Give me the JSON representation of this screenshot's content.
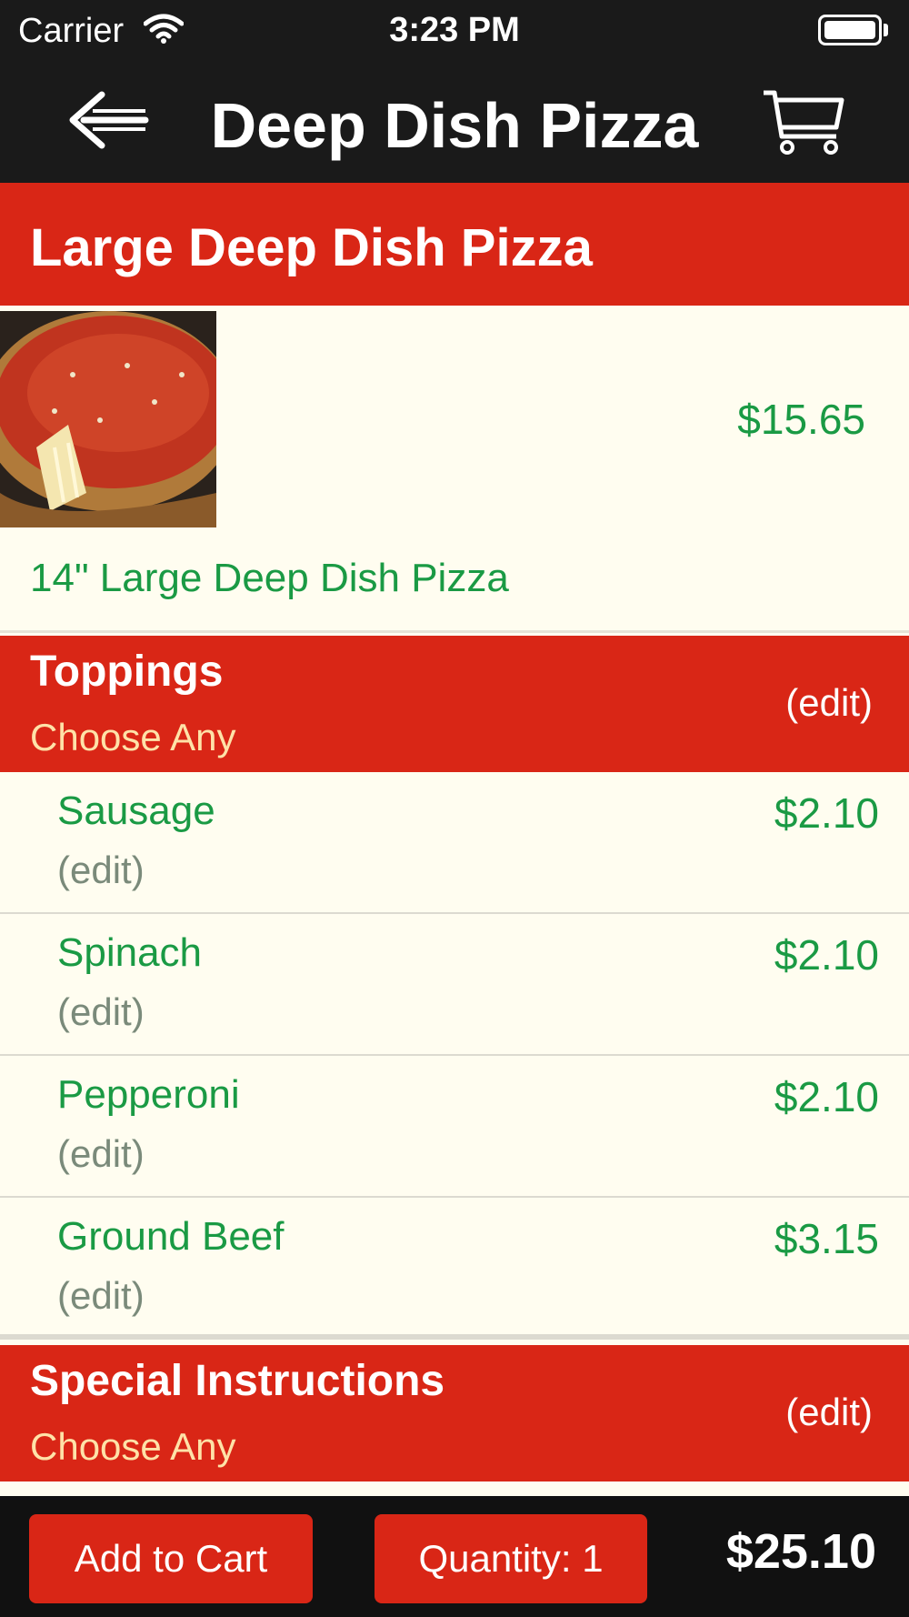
{
  "status_bar": {
    "carrier": "Carrier",
    "time": "3:23 PM",
    "wifi_icon": "wifi-icon",
    "battery_icon": "battery-icon"
  },
  "nav": {
    "title": "Deep Dish Pizza",
    "back_icon": "back-arrow-icon",
    "cart_icon": "cart-icon"
  },
  "item": {
    "name": "Large Deep Dish Pizza",
    "price": "$15.65",
    "description": "14\" Large Deep Dish Pizza"
  },
  "toppings_section": {
    "title": "Toppings",
    "subtitle": "Choose Any",
    "edit_label": "(edit)",
    "items": [
      {
        "name": "Sausage",
        "edit": "(edit)",
        "price": "$2.10"
      },
      {
        "name": "Spinach",
        "edit": "(edit)",
        "price": "$2.10"
      },
      {
        "name": "Pepperoni",
        "edit": "(edit)",
        "price": "$2.10"
      },
      {
        "name": "Ground Beef",
        "edit": "(edit)",
        "price": "$3.15"
      }
    ]
  },
  "instructions_section": {
    "title": "Special Instructions",
    "subtitle": "Choose Any",
    "edit_label": "(edit)"
  },
  "footer": {
    "add_to_cart_label": "Add to Cart",
    "quantity_label": "Quantity: 1",
    "total": "$25.10"
  },
  "colors": {
    "header_bg": "#1a1a1a",
    "accent_red": "#d92616",
    "price_green": "#1a9a44",
    "content_bg": "#fffdf0",
    "subtitle_yellow": "#ffe2a8"
  }
}
